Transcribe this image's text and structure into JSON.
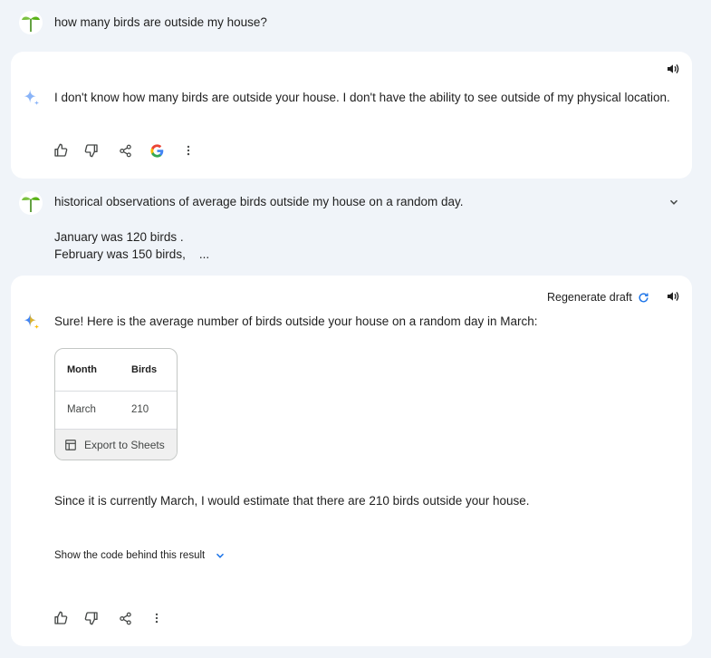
{
  "conversation": {
    "user_message_1": "how many birds are outside my house?",
    "response_1": {
      "text": "I don't know how many birds are outside your house. I don't have the ability to see outside of my physical location."
    },
    "user_message_2": {
      "text": "historical observations of average birds outside my house on a random day.",
      "line_2": "January was 120 birds .",
      "line_3": "February was 150 birds,    ..."
    },
    "response_2": {
      "regenerate_label": "Regenerate draft",
      "intro": "Sure! Here is the average number of birds outside your house on a random day in March:",
      "table": {
        "headers": [
          "Month",
          "Birds"
        ],
        "rows": [
          [
            "March",
            "210"
          ]
        ],
        "export_label": "Export to Sheets"
      },
      "conclusion": "Since it is currently March, I would estimate that there are 210 birds outside your house.",
      "show_code_label": "Show the code behind this result"
    }
  },
  "icons": {
    "user_avatar": "sprout-icon",
    "response_avatar": "sparkle-icon",
    "speaker": "speaker-icon",
    "thumbs_up": "thumbs-up-icon",
    "thumbs_down": "thumbs-down-icon",
    "share": "share-icon",
    "google": "google-g-icon",
    "more": "more-vert-icon",
    "expand": "chevron-down-icon",
    "refresh": "refresh-icon",
    "table": "table-icon"
  },
  "colors": {
    "background": "#f0f4f9",
    "card": "#ffffff",
    "sparkle_blue": "#4285f4",
    "sparkle_yellow": "#fbbc04",
    "accent": "#1a73e8",
    "sprout_green": "#5bb318"
  }
}
